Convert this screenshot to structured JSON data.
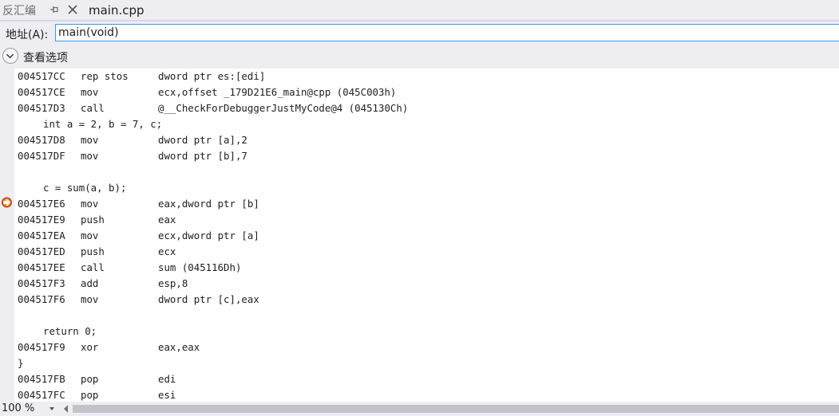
{
  "tabs": {
    "inactive_label": "反汇编",
    "active_label": "main.cpp"
  },
  "address": {
    "label": "地址(A):",
    "value": "main(void)"
  },
  "options": {
    "label": "查看选项"
  },
  "code": {
    "lines": [
      {
        "addr": "004517CC",
        "mn": "rep stos",
        "op": "dword ptr es:[edi]"
      },
      {
        "addr": "004517CE",
        "mn": "mov",
        "op": "ecx,offset _179D21E6_main@cpp (045C003h)"
      },
      {
        "addr": "004517D3",
        "mn": "call",
        "op": "@__CheckForDebuggerJustMyCode@4 (045130Ch)"
      },
      {
        "src": "int a = 2, b = 7, c;"
      },
      {
        "addr": "004517D8",
        "mn": "mov",
        "op": "dword ptr [a],2"
      },
      {
        "addr": "004517DF",
        "mn": "mov",
        "op": "dword ptr [b],7"
      },
      {
        "src": ""
      },
      {
        "src": "c = sum(a, b);"
      },
      {
        "addr": "004517E6",
        "mn": "mov",
        "op": "eax,dword ptr [b]"
      },
      {
        "addr": "004517E9",
        "mn": "push",
        "op": "eax"
      },
      {
        "addr": "004517EA",
        "mn": "mov",
        "op": "ecx,dword ptr [a]"
      },
      {
        "addr": "004517ED",
        "mn": "push",
        "op": "ecx"
      },
      {
        "addr": "004517EE",
        "mn": "call",
        "op": "sum (045116Dh)"
      },
      {
        "addr": "004517F3",
        "mn": "add",
        "op": "esp,8"
      },
      {
        "addr": "004517F6",
        "mn": "mov",
        "op": "dword ptr [c],eax"
      },
      {
        "src": ""
      },
      {
        "src": "return 0;"
      },
      {
        "addr": "004517F9",
        "mn": "xor",
        "op": "eax,eax"
      },
      {
        "brace": "}"
      },
      {
        "addr": "004517FB",
        "mn": "pop",
        "op": "edi"
      },
      {
        "addr": "004517FC",
        "mn": "pop",
        "op": "esi"
      }
    ]
  },
  "status": {
    "zoom": "100 %"
  },
  "colors": {
    "accent": "#3399ff",
    "breakpoint_arrow": "#e8a317",
    "breakpoint_ring": "#c0392b"
  }
}
